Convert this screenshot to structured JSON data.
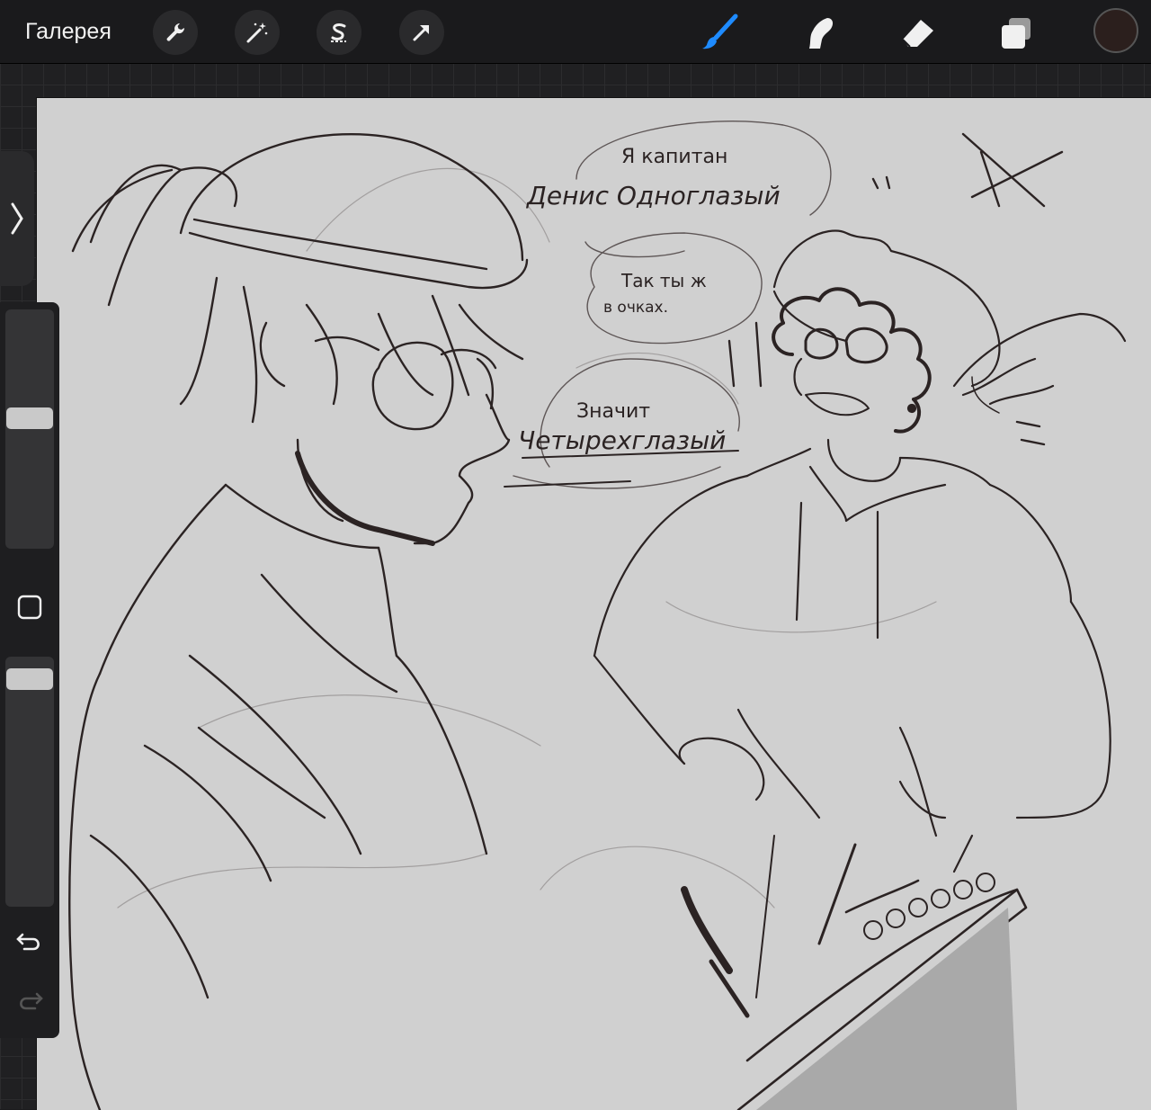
{
  "topbar": {
    "gallery_label": "Галерея",
    "left_tools": [
      "wrench-icon",
      "magic-wand-icon",
      "selection-s-icon",
      "transform-arrow-icon"
    ],
    "right_tools": [
      "brush-icon",
      "smudge-icon",
      "eraser-icon",
      "layers-icon"
    ],
    "active_tool": "brush-icon",
    "accent_color": "#1e8bff",
    "current_color": "#2b1f1d"
  },
  "sidebar": {
    "size_slider_level": 0.55,
    "opacity_slider_level": 0.95
  },
  "canvas": {
    "background": "#d0d0d0",
    "speech_bubbles": [
      {
        "line1": "Я капитан",
        "line2": "Денис Одноглазый"
      },
      {
        "line1": "Так ты ж",
        "line2": "в очках."
      },
      {
        "line1": "Значит",
        "line2": "Четырехглазый"
      }
    ]
  }
}
